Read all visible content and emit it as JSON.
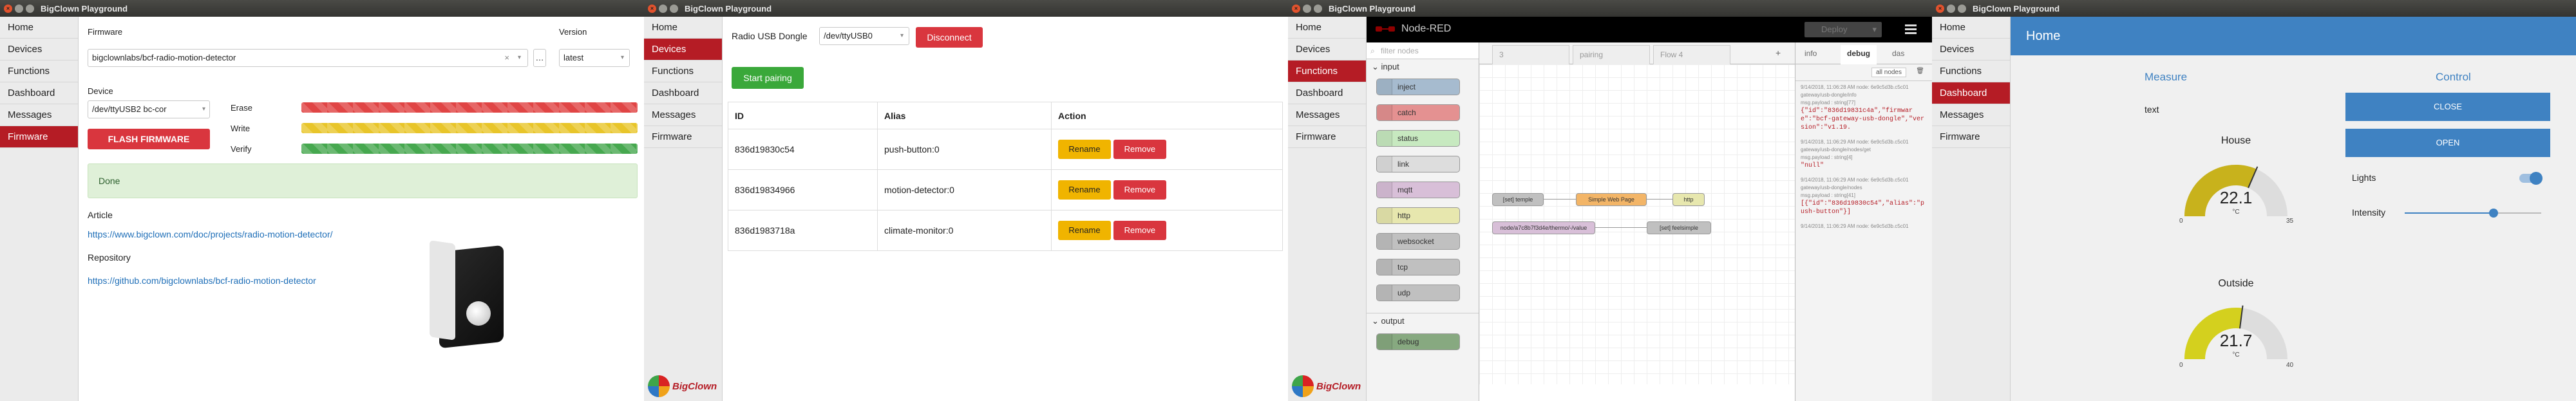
{
  "app_title": "BigClown Playground",
  "sidebar": [
    "Home",
    "Devices",
    "Functions",
    "Dashboard",
    "Messages",
    "Firmware"
  ],
  "logo_text": "BigClown",
  "firmware_panel": {
    "firmware_label": "Firmware",
    "firmware_value": "bigclownlabs/bcf-radio-motion-detector",
    "version_label": "Version",
    "version_value": "latest",
    "device_label": "Device",
    "device_value": "/dev/ttyUSB2 bc-cor",
    "erase_label": "Erase",
    "write_label": "Write",
    "verify_label": "Verify",
    "flash_button": "FLASH FIRMWARE",
    "done_text": "Done",
    "article_label": "Article",
    "article_link": "https://www.bigclown.com/doc/projects/radio-motion-detector/",
    "repo_label": "Repository",
    "repo_link": "https://github.com/bigclownlabs/bcf-radio-motion-detector",
    "progress": {
      "erase": 1,
      "write": 1,
      "verify": 1
    }
  },
  "devices_panel": {
    "dongle_label": "Radio USB Dongle",
    "dongle_value": "/dev/ttyUSB0",
    "disconnect_button": "Disconnect",
    "pairing_button": "Start pairing",
    "columns": [
      "ID",
      "Alias",
      "Action"
    ],
    "rows": [
      {
        "id": "836d19830c54",
        "alias": "push-button:0"
      },
      {
        "id": "836d19834966",
        "alias": "motion-detector:0"
      },
      {
        "id": "836d1983718a",
        "alias": "climate-monitor:0"
      }
    ],
    "rename_label": "Rename",
    "remove_label": "Remove"
  },
  "nodered_panel": {
    "title": "Node-RED",
    "deploy_label": "Deploy",
    "filter_placeholder": "filter nodes",
    "category_input": "input",
    "category_output": "output",
    "input_nodes": [
      "inject",
      "catch",
      "status",
      "link",
      "mqtt",
      "http",
      "websocket",
      "tcp",
      "udp"
    ],
    "output_nodes": [
      "debug"
    ],
    "tabs": [
      "3",
      "pairing",
      "Flow 4"
    ],
    "side_tabs": [
      "info",
      "debug",
      "das"
    ],
    "all_nodes_label": "all nodes",
    "flow_nodes": [
      "[set] temple",
      "Simple Web Page",
      "http",
      "node/a7c8b7f3d4e/thermo/-/value",
      "[set] feelsimple"
    ],
    "debug_messages": [
      {
        "meta": "9/14/2018, 11:06:28 AM   node: 6e9c5d3b.c5c01",
        "topic": "gateway/usb-dongle/info",
        "type": "msg.payload : string[77]",
        "value": "{\"id\":\"836d19831c4a\",\"firmware\":\"bcf-gateway-usb-dongle\",\"version\":\"v1.19."
      },
      {
        "meta": "9/14/2018, 11:06:29 AM   node: 6e9c5d3b.c5c01",
        "topic": "gateway/usb-dongle/nodes/get",
        "type": "msg.payload : string[4]",
        "value": "\"null\""
      },
      {
        "meta": "9/14/2018, 11:06:29 AM   node: 6e9c5d3b.c5c01",
        "topic": "gateway/usb-dongle/nodes",
        "type": "msg.payload : string[41]",
        "value": "[{\"id\":\"836d19830c54\",\"alias\":\"push-button\"}]"
      },
      {
        "meta": "9/14/2018, 11:06:29 AM   node: 6e9c5d3b.c5c01",
        "topic": "",
        "type": "",
        "value": ""
      }
    ]
  },
  "dashboard_panel": {
    "header": "Home",
    "measure_title": "Measure",
    "control_title": "Control",
    "text_label": "text",
    "close_button": "CLOSE",
    "open_button": "OPEN",
    "lights_label": "Lights",
    "intensity_label": "Intensity",
    "intensity_value": 0.65,
    "lights_on": true,
    "gauges": [
      {
        "title": "House",
        "value": "22.1",
        "unit": "°C",
        "min": "0",
        "max": "35",
        "fill": 0.63,
        "color": "#c8b21c"
      },
      {
        "title": "Outside",
        "value": "21.7",
        "unit": "°C",
        "min": "0",
        "max": "40",
        "fill": 0.54,
        "color": "#d4d01e"
      }
    ]
  },
  "colors": {
    "brand_red": "#b51c25",
    "dash_blue": "#3f82c2",
    "nr_header": "#000000"
  }
}
